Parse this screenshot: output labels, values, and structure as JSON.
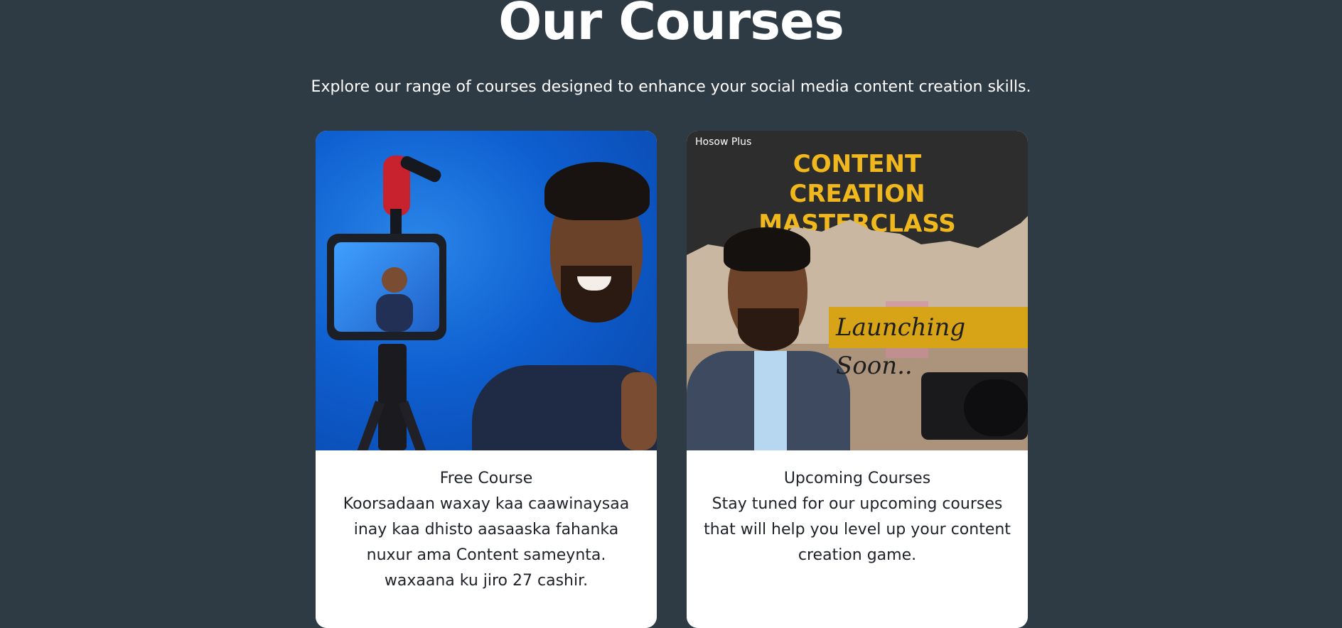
{
  "header": {
    "title": "Our Courses",
    "subtitle": "Explore our range of courses designed to enhance your social media content creation skills."
  },
  "courses": [
    {
      "title": "Free Course",
      "description": "Koorsadaan waxay kaa caawinaysaa inay kaa dhisto aasaaska fahanka nuxur ama Content sameynta. waxaana ku jiro 27 cashir."
    },
    {
      "title": "Upcoming Courses",
      "description": "Stay tuned for our upcoming courses that will help you level up your content creation game.",
      "image": {
        "brand": "Hosow Plus",
        "headline": "CONTENT CREATION MASTERCLASS",
        "banner": "Launching Soon.."
      }
    }
  ],
  "colors": {
    "background": "#2e3a44",
    "card": "#ffffff",
    "accent": "#f0b81c"
  }
}
